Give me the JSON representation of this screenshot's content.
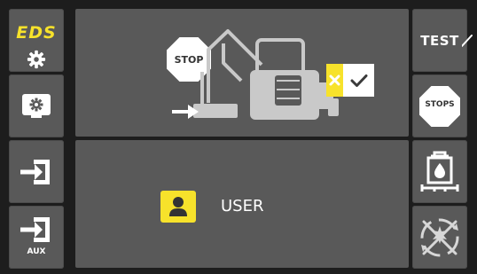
{
  "colors": {
    "accent_yellow": "#f7e22b",
    "panel_gray": "#595959",
    "frame_dark": "#1d1d1d",
    "icon_light": "#d7d7d7"
  },
  "left_column": {
    "eds_label": "EDS",
    "aux_label": "AUX",
    "icons": [
      "gear-icon",
      "display-settings-icon",
      "input-enter-icon",
      "aux-input-icon"
    ]
  },
  "center": {
    "top_panel": {
      "stop_sign_label": "STOP",
      "icons": [
        "stop-sign-icon",
        "excavator-icon",
        "arrow-right-icon",
        "cross-check-toggle-icon"
      ]
    },
    "bottom_panel": {
      "user_label": "USER",
      "icons": [
        "user-icon"
      ]
    }
  },
  "right_column": {
    "test_label": "TEST",
    "stops_label": "STOPS",
    "icons": [
      "stop-sign-icon",
      "tank-level-icon",
      "disabled-rotation-icon"
    ]
  }
}
